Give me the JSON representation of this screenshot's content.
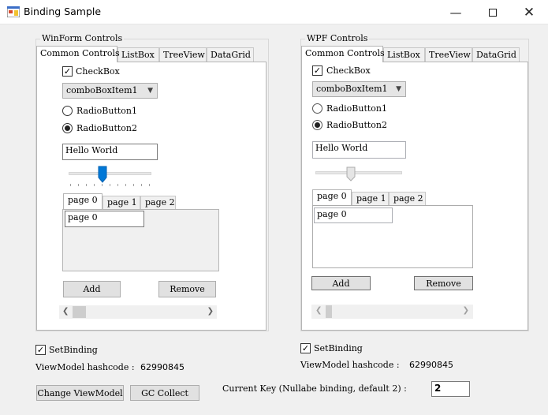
{
  "window": {
    "title": "Binding Sample"
  },
  "winforms": {
    "group_label": "WinForm Controls",
    "tabs": [
      "Common Controls",
      "ListBox",
      "TreeView",
      "DataGrid"
    ],
    "checkbox_label": "CheckBox",
    "combo_value": "comboBoxItem1",
    "radio1_label": "RadioButton1",
    "radio2_label": "RadioButton2",
    "textbox_value": "Hello World",
    "subtabs": [
      "page 0",
      "page 1",
      "page 2"
    ],
    "page_text": "page 0",
    "add_label": "Add",
    "remove_label": "Remove",
    "setbinding_label": "SetBinding",
    "hashcode_label": "ViewModel hashcode :",
    "hashcode_value": "62990845"
  },
  "wpf": {
    "group_label": "WPF Controls",
    "tabs": [
      "Common Controls",
      "ListBox",
      "TreeView",
      "DataGrid"
    ],
    "checkbox_label": "CheckBox",
    "combo_value": "comboBoxItem1",
    "radio1_label": "RadioButton1",
    "radio2_label": "RadioButton2",
    "textbox_value": "Hello World",
    "subtabs": [
      "page 0",
      "page 1",
      "page 2"
    ],
    "page_text": "page 0",
    "add_label": "Add",
    "remove_label": "Remove",
    "setbinding_label": "SetBinding",
    "hashcode_label": "ViewModel hashcode :",
    "hashcode_value": "62990845"
  },
  "footer": {
    "change_viewmodel_label": "Change ViewModel",
    "gc_collect_label": "GC Collect",
    "current_key_label": "Current Key (Nullabe binding, default 2) :",
    "current_key_value": "2"
  },
  "state": {
    "winforms_slider_fraction": 0.4,
    "wpf_slider_fraction": 0.4,
    "winforms_checkbox_checked": true,
    "wpf_checkbox_checked": true,
    "setbinding_checked": true
  },
  "icons": {
    "minimize": "minimize-icon",
    "maximize": "maximize-icon",
    "close": "close-icon",
    "check": "check-icon",
    "chevron_down": "chevron-down-icon",
    "scroll_left": "scroll-left-icon",
    "scroll_right": "scroll-right-icon"
  },
  "colors": {
    "slider_thumb_active": "#0078d7",
    "slider_thumb_inactive": "#e5e5e5",
    "window_bg": "#f0f0f0"
  }
}
